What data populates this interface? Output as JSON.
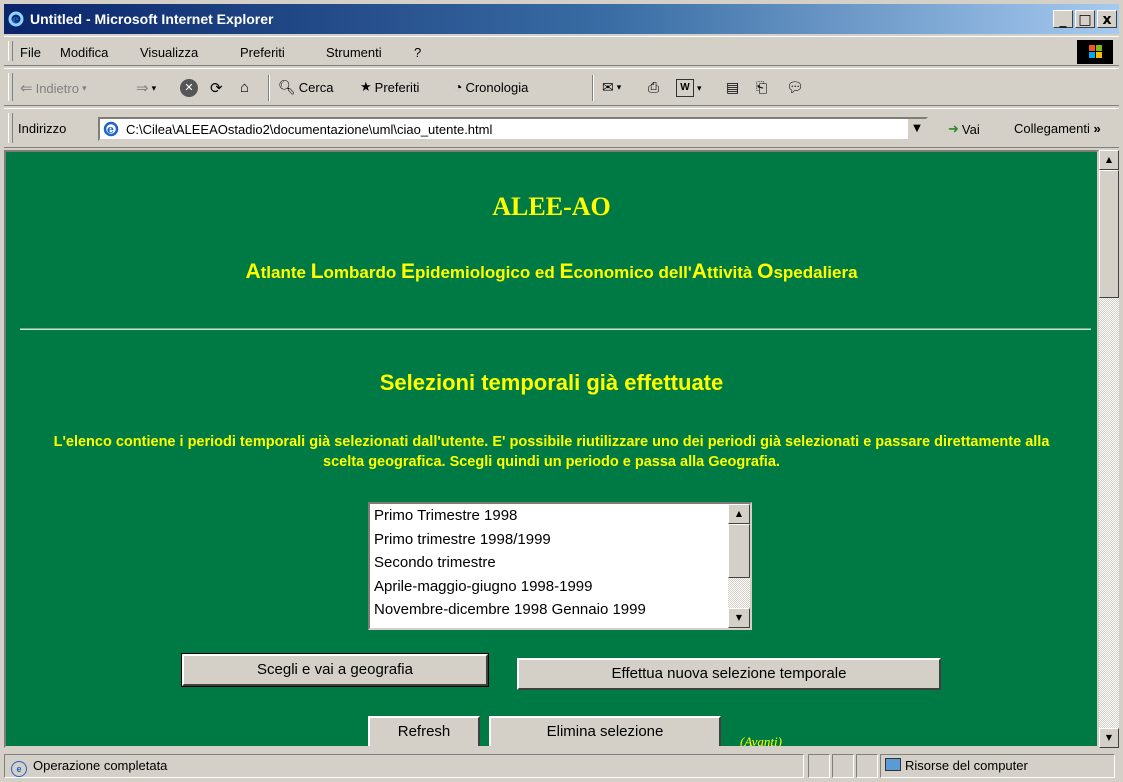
{
  "window": {
    "title": "Untitled - Microsoft Internet Explorer",
    "min": "_",
    "max": "□",
    "close": "x"
  },
  "menu": [
    "File",
    "Modifica",
    "Visualizza",
    "Preferiti",
    "Strumenti",
    "?"
  ],
  "toolbar": {
    "back": "Indietro",
    "search": "Cerca",
    "favorites": "Preferiti",
    "history": "Cronologia"
  },
  "address": {
    "label": "Indirizzo",
    "url": "C:\\Cilea\\ALEEAOstadio2\\documentazione\\uml\\ciao_utente.html",
    "go": "Vai",
    "links": "Collegamenti"
  },
  "page": {
    "title": "ALEE-AO",
    "subtitle_parts": [
      {
        "cap": "A",
        "rest": "tlante "
      },
      {
        "cap": "L",
        "rest": "ombardo "
      },
      {
        "cap": "E",
        "rest": "pidemiologico ed "
      },
      {
        "cap": "E",
        "rest": "conomico dell'"
      },
      {
        "cap": "A",
        "rest": "ttività "
      },
      {
        "cap": "O",
        "rest": "spedaliera"
      }
    ],
    "section_title": "Selezioni temporali già effettuate",
    "description": "L'elenco contiene i periodi temporali già selezionati dall'utente. E' possibile riutilizzare uno dei periodi già selezionati e passare direttamente alla scelta geografica. Scegli quindi un periodo e passa alla Geografia.",
    "periods": [
      "Primo Trimestre 1998",
      "Primo trimestre 1998/1999",
      "Secondo trimestre",
      "Aprile-maggio-giugno 1998-1999",
      "Novembre-dicembre 1998 Gennaio 1999"
    ],
    "btn_choose": "Scegli e vai a geografia",
    "btn_new": "Effettua nuova selezione temporale",
    "btn_refresh": "Refresh",
    "btn_delete": "Elimina selezione",
    "avanti": "Avanti"
  },
  "status": {
    "text": "Operazione completata",
    "zone": "Risorse del computer"
  },
  "colors": {
    "page_bg": "#007a45",
    "page_text": "#ffff00",
    "titlebar": "#0a246a"
  }
}
